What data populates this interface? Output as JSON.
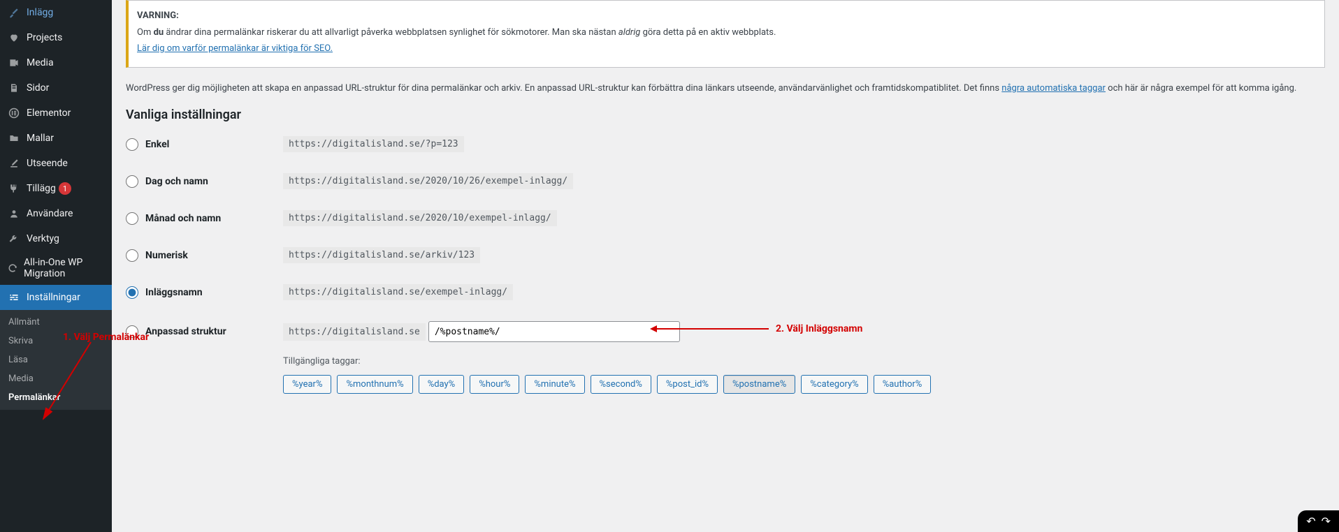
{
  "sidebar": {
    "items": [
      {
        "icon": "pin-icon",
        "label": "Inlägg"
      },
      {
        "icon": "heart-icon",
        "label": "Projects"
      },
      {
        "icon": "media-icon",
        "label": "Media"
      },
      {
        "icon": "page-icon",
        "label": "Sidor"
      },
      {
        "icon": "elementor-icon",
        "label": "Elementor"
      },
      {
        "icon": "templates-icon",
        "label": "Mallar"
      },
      {
        "icon": "brush-icon",
        "label": "Utseende"
      },
      {
        "icon": "plugin-icon",
        "label": "Tillägg",
        "badge": "1"
      },
      {
        "icon": "users-icon",
        "label": "Användare"
      },
      {
        "icon": "wrench-icon",
        "label": "Verktyg"
      },
      {
        "icon": "migration-icon",
        "label": "All-in-One WP Migration"
      },
      {
        "icon": "settings-icon",
        "label": "Inställningar",
        "active": true
      }
    ],
    "submenu": [
      {
        "label": "Allmänt"
      },
      {
        "label": "Skriva"
      },
      {
        "label": "Läsa"
      },
      {
        "label": "Media"
      },
      {
        "label": "Permalänkar",
        "current": true
      }
    ]
  },
  "notice": {
    "heading": "VARNING:",
    "text_before_bold": "Om ",
    "text_bold1": "du",
    "text_after_bold1": " ändrar dina permalänkar riskerar du att allvarligt påverka webbplatsen synlighet för sökmotorer. Man ska nästan ",
    "text_italic": "aldrig",
    "text_after_italic": " göra detta på en aktiv webbplats.",
    "link": "Lär dig om varför permalänkar är viktiga för SEO."
  },
  "description": {
    "text": "WordPress ger dig möjligheten att skapa en anpassad URL-struktur för dina permalänkar och arkiv. En anpassad URL-struktur kan förbättra dina länkars utseende, användarvänlighet och framtidskompatiblitet. Det finns ",
    "link": "några automatiska taggar",
    "after": " och här är några exempel för att komma igång."
  },
  "section_title": "Vanliga inställningar",
  "options": [
    {
      "label": "Enkel",
      "url": "https://digitalisland.se/?p=123",
      "checked": false
    },
    {
      "label": "Dag och namn",
      "url": "https://digitalisland.se/2020/10/26/exempel-inlagg/",
      "checked": false
    },
    {
      "label": "Månad och namn",
      "url": "https://digitalisland.se/2020/10/exempel-inlagg/",
      "checked": false
    },
    {
      "label": "Numerisk",
      "url": "https://digitalisland.se/arkiv/123",
      "checked": false
    },
    {
      "label": "Inläggsnamn",
      "url": "https://digitalisland.se/exempel-inlagg/",
      "checked": true
    },
    {
      "label": "Anpassad struktur",
      "url": "https://digitalisland.se",
      "checked": false,
      "custom": true,
      "value": "/%postname%/"
    }
  ],
  "tags_label": "Tillgängliga taggar:",
  "tags": [
    {
      "t": "%year%"
    },
    {
      "t": "%monthnum%"
    },
    {
      "t": "%day%"
    },
    {
      "t": "%hour%"
    },
    {
      "t": "%minute%"
    },
    {
      "t": "%second%"
    },
    {
      "t": "%post_id%"
    },
    {
      "t": "%postname%",
      "active": true
    },
    {
      "t": "%category%"
    },
    {
      "t": "%author%"
    }
  ],
  "annotations": {
    "a1": "1. Välj Permalänkar",
    "a2": "2. Välj Inläggsnamn"
  },
  "icons": {
    "pin": "📌",
    "heart": "♥",
    "media": "🎵",
    "page": "▯",
    "elementor": "Ⓔ",
    "templates": "📁",
    "brush": "🖌",
    "plugin": "🔌",
    "users": "👤",
    "wrench": "🔧",
    "migration": "🔄",
    "settings": "⚙",
    "sliders": "⎚"
  }
}
